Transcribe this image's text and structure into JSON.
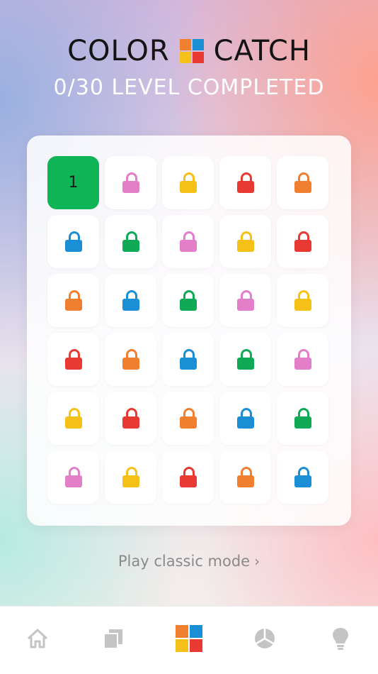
{
  "header": {
    "title_left": "COLOR",
    "title_right": "CATCH",
    "logo_colors": [
      "#f08030",
      "#1b8fd6",
      "#f5c018",
      "#e83a32"
    ],
    "progress_text": "0/30 LEVEL COMPLETED"
  },
  "levels": {
    "current": {
      "number": "1",
      "color": "#0fb457"
    },
    "locked_colors": [
      "#e37fc9",
      "#f5c018",
      "#e83a32",
      "#f08030",
      "#1b8fd6",
      "#10a955",
      "#e37fc9",
      "#f5c018",
      "#e83a32",
      "#f08030",
      "#1b8fd6",
      "#10a955",
      "#e37fc9",
      "#f5c018",
      "#e83a32",
      "#f08030",
      "#1b8fd6",
      "#10a955",
      "#e37fc9",
      "#f5c018",
      "#e83a32",
      "#f08030",
      "#1b8fd6",
      "#10a955",
      "#e37fc9",
      "#f5c018",
      "#e83a32",
      "#f08030",
      "#1b8fd6"
    ]
  },
  "classic_link": {
    "label": "Play classic mode",
    "chevron": "›"
  },
  "tabbar": {
    "tabs": [
      {
        "icon": "home-icon",
        "active": false
      },
      {
        "icon": "cards-icon",
        "active": false
      },
      {
        "icon": "levels-grid-icon",
        "active": true
      },
      {
        "icon": "stats-pie-icon",
        "active": false
      },
      {
        "icon": "lightbulb-icon",
        "active": false
      }
    ]
  }
}
